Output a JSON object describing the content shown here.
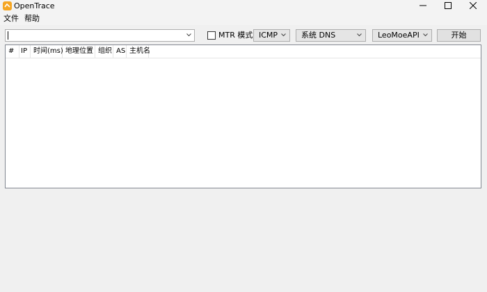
{
  "window": {
    "title": "OpenTrace",
    "app_icon": "opentrace-logo-icon",
    "controls": [
      "minimize-icon",
      "maximize-icon",
      "close-icon"
    ]
  },
  "menu": {
    "file": "文件",
    "help": "帮助"
  },
  "toolbar": {
    "target_value": "",
    "mtr_checked": false,
    "mtr_label": "MTR 模式",
    "protocol": "ICMP",
    "dns": "系统 DNS",
    "api": "LeoMoeAPI",
    "start_label": "开始"
  },
  "table": {
    "columns": [
      "#",
      "IP",
      "时间(ms)",
      "地理位置",
      "组织",
      "AS",
      "主机名"
    ],
    "rows": []
  },
  "colors": {
    "accent_icon": "#f5a623",
    "window_bg": "#f0f0f0"
  }
}
